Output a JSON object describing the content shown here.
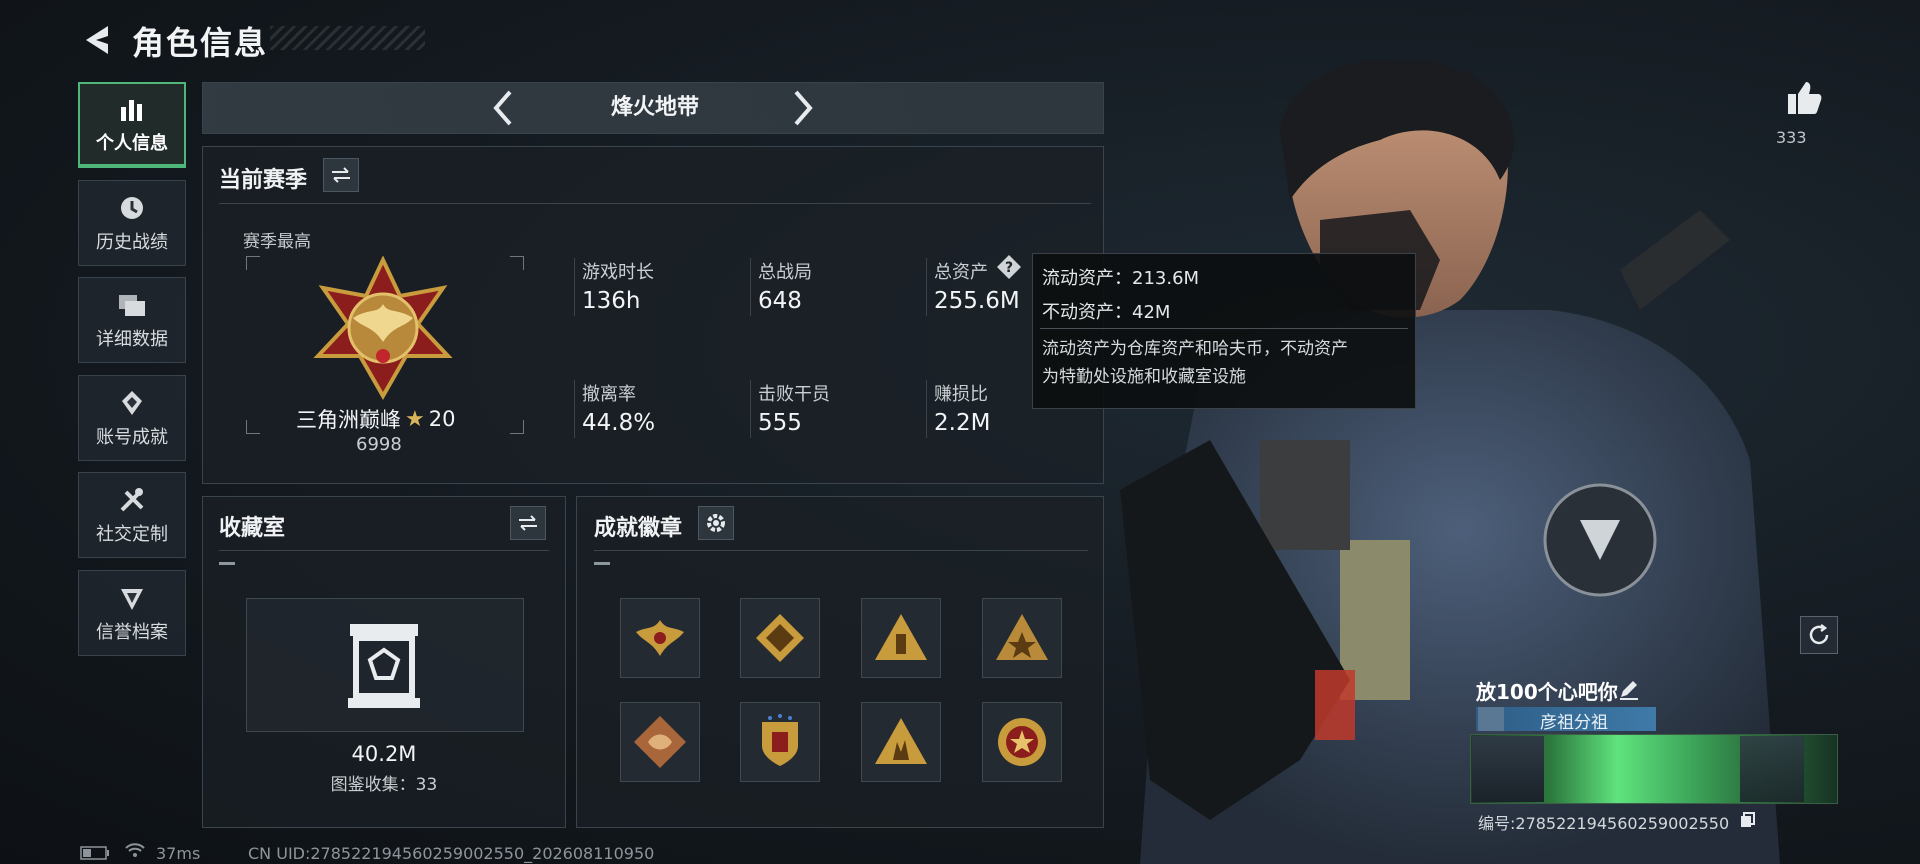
{
  "header": {
    "title": "角色信息"
  },
  "nav": {
    "items": [
      {
        "label": "个人信息",
        "icon": "bar-chart-icon",
        "active": true
      },
      {
        "label": "历史战绩",
        "icon": "clock-icon"
      },
      {
        "label": "详细数据",
        "icon": "folders-icon"
      },
      {
        "label": "账号成就",
        "icon": "achievement-icon"
      },
      {
        "label": "社交定制",
        "icon": "tools-icon"
      },
      {
        "label": "信誉档案",
        "icon": "credibility-icon"
      }
    ]
  },
  "mode": {
    "title": "烽火地带"
  },
  "season": {
    "title": "当前赛季",
    "best_label": "赛季最高",
    "rank_name": "三角洲巅峰",
    "rank_stars": "20",
    "rank_score": "6998",
    "stats": [
      {
        "label": "游戏时长",
        "value": "136h"
      },
      {
        "label": "总战局",
        "value": "648"
      },
      {
        "label": "总资产",
        "value": "255.6M"
      },
      {
        "label": "撤离率",
        "value": "44.8%"
      },
      {
        "label": "击败干员",
        "value": "555"
      },
      {
        "label": "赚损比",
        "value": "2.2M"
      }
    ]
  },
  "tooltip": {
    "liquid": "流动资产：213.6M",
    "fixed": "不动资产：42M",
    "desc_line1": "流动资产为仓库资产和哈夫币，不动资产",
    "desc_line2": "为特勤处设施和收藏室设施"
  },
  "collection": {
    "title": "收藏室",
    "value": "40.2M",
    "count_text": "图鉴收集：33"
  },
  "badges": {
    "title": "成就徽章",
    "items": [
      {
        "icon": "winged-eagle-badge-icon"
      },
      {
        "icon": "diamond-emblem-badge-icon"
      },
      {
        "icon": "triangle-tower-badge-icon"
      },
      {
        "icon": "triangle-star-badge-icon"
      },
      {
        "icon": "dragon-badge-icon"
      },
      {
        "icon": "shield-stars-badge-icon"
      },
      {
        "icon": "triangle-figures-badge-icon"
      },
      {
        "icon": "round-star-badge-icon"
      }
    ]
  },
  "player": {
    "likes": "333",
    "name": "放100个心吧你",
    "clan": "彦祖分祖",
    "id_text": "编号:278522194560259002550"
  },
  "status": {
    "ping": "37ms",
    "uid": "CN UID:278522194560259002550_202608110950"
  },
  "colors": {
    "accent_green": "#4fb77a",
    "gold": "#c89b3c",
    "clan_blue": "#3f7aa8"
  }
}
